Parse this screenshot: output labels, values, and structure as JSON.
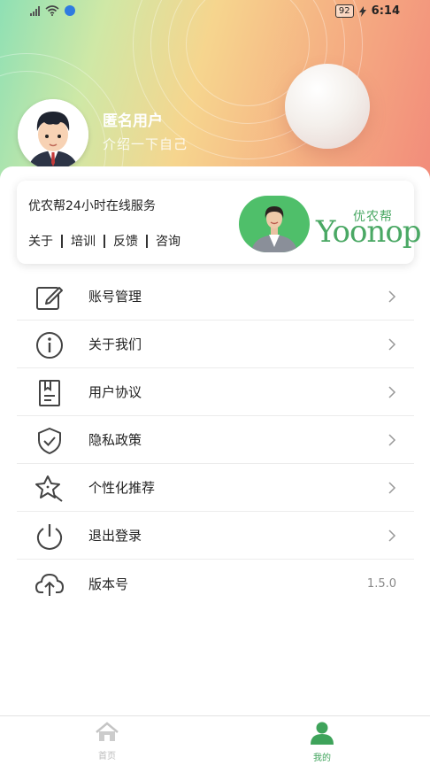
{
  "status_bar": {
    "battery": "92",
    "time": "6:14"
  },
  "profile": {
    "name": "匿名用户",
    "intro": "介绍一下自己"
  },
  "service": {
    "title": "优农帮24小时在线服务",
    "links": [
      "关于",
      "培训",
      "反馈",
      "咨询"
    ],
    "brand_cn": "优农帮",
    "brand_en": "Yoonop"
  },
  "menu": {
    "items": [
      {
        "label": "账号管理",
        "icon": "edit-icon"
      },
      {
        "label": "关于我们",
        "icon": "info-icon"
      },
      {
        "label": "用户协议",
        "icon": "document-icon"
      },
      {
        "label": "隐私政策",
        "icon": "shield-icon"
      },
      {
        "label": "个性化推荐",
        "icon": "star-icon"
      },
      {
        "label": "退出登录",
        "icon": "power-icon"
      }
    ],
    "version": {
      "label": "版本号",
      "value": "1.5.0",
      "icon": "cloud-upload-icon"
    }
  },
  "tabbar": {
    "home": "首页",
    "mine": "我的"
  },
  "colors": {
    "accent": "#3ea35a",
    "brand": "#4aa864"
  }
}
